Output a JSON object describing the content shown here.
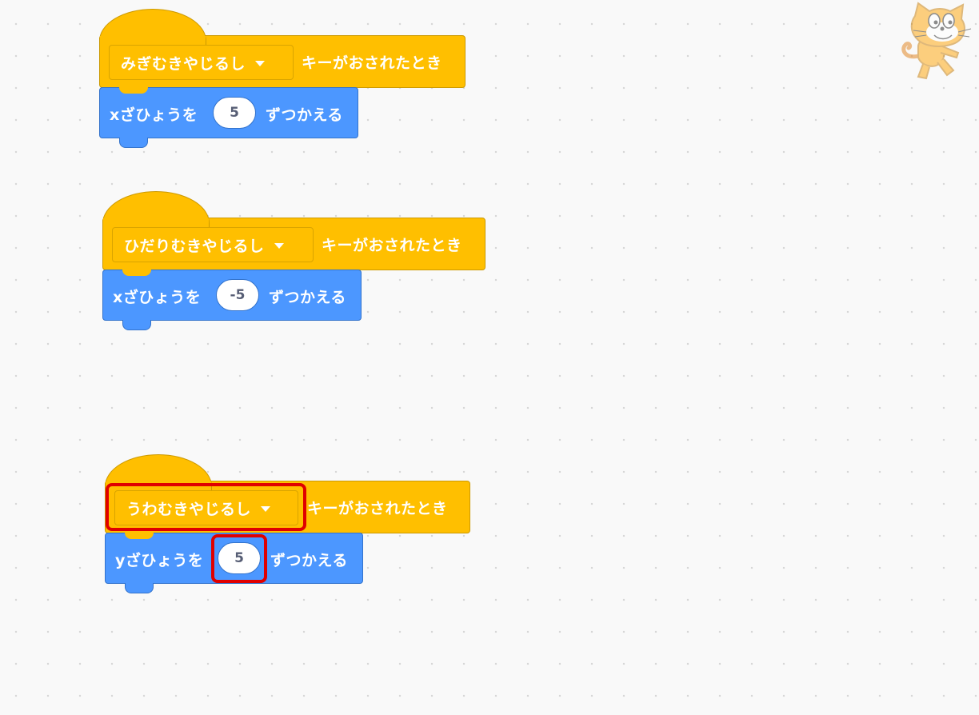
{
  "scripts": [
    {
      "hat": {
        "key": "みぎむきやじるし",
        "label": "キーがおされたとき"
      },
      "motion": {
        "prefix": "xざひょうを",
        "value": "5",
        "suffix": "ずつかえる"
      }
    },
    {
      "hat": {
        "key": "ひだりむきやじるし",
        "label": "キーがおされたとき"
      },
      "motion": {
        "prefix": "xざひょうを",
        "value": "-5",
        "suffix": "ずつかえる"
      }
    },
    {
      "hat": {
        "key": "うわむきやじるし",
        "label": "キーがおされたとき"
      },
      "motion": {
        "prefix": "yざひょうを",
        "value": "5",
        "suffix": "ずつかえる"
      }
    }
  ],
  "colors": {
    "events_block": "#ffbf00",
    "motion_block": "#4c97ff",
    "highlight": "#e00000",
    "canvas_background": "#f9f9f9"
  },
  "sprite_icon": "scratch-cat-icon"
}
